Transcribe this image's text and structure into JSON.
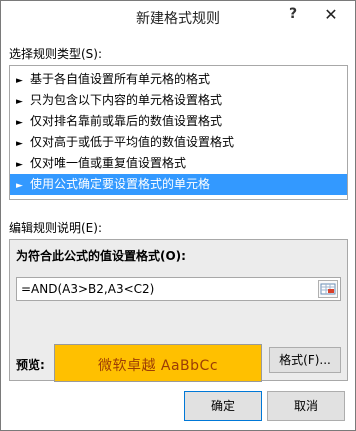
{
  "dialog": {
    "title": "新建格式规则",
    "help_label": "?",
    "close_label": "✕"
  },
  "rule_type": {
    "label": "选择规则类型(S):",
    "items": [
      {
        "label": "基于各自值设置所有单元格的格式",
        "selected": false
      },
      {
        "label": "只为包含以下内容的单元格设置格式",
        "selected": false
      },
      {
        "label": "仅对排名靠前或靠后的数值设置格式",
        "selected": false
      },
      {
        "label": "仅对高于或低于平均值的数值设置格式",
        "selected": false
      },
      {
        "label": "仅对唯一值或重复值设置格式",
        "selected": false
      },
      {
        "label": "使用公式确定要设置格式的单元格",
        "selected": true
      }
    ],
    "item_arrow": "►"
  },
  "description": {
    "label": "编辑规则说明(E):",
    "formula_label": "为符合此公式的值设置格式(O):",
    "formula_value": "=AND(A3>B2,A3<C2)",
    "range_button_icon": "collapse-range-icon",
    "preview_label": "预览:",
    "preview_text": "微软卓越  AaBbCc",
    "preview_fill": "#ffc000",
    "preview_font_color": "#9c3d06",
    "format_button": "格式(F)..."
  },
  "footer": {
    "ok_label": "确定",
    "cancel_label": "取消"
  },
  "colors": {
    "selection": "#3399ff"
  }
}
